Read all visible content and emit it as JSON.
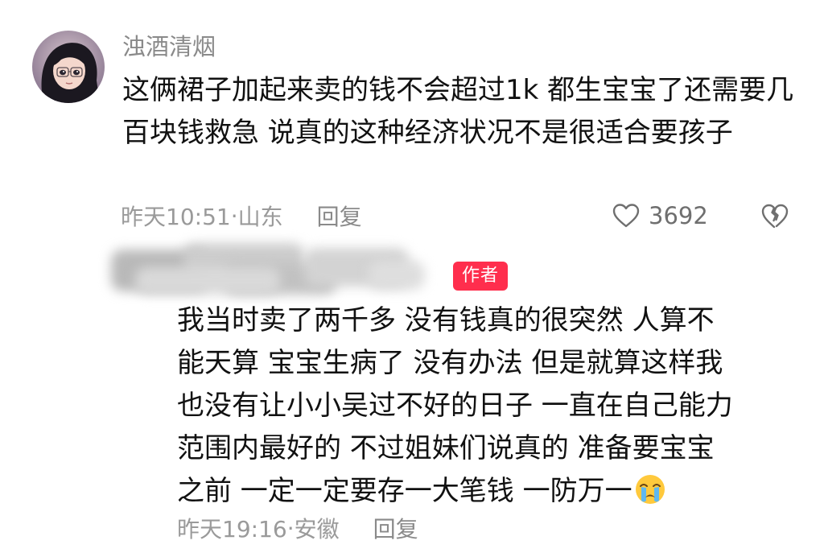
{
  "comment": {
    "username": "浊酒清烟",
    "text": "这俩裙子加起来卖的钱不会超过1k 都生宝宝了还需要几百块钱救急 说真的这种经济状况不是很适合要孩子",
    "time": "昨天10:51",
    "location": "山东",
    "reply_label": "回复",
    "like_count": "3692"
  },
  "reply": {
    "badge": "作者",
    "lines": [
      "我当时卖了两千多 没有钱真的很突然 人算不",
      "能天算 宝宝生病了 没有办法 但是就算这样我",
      "也没有让小小吴过不好的日子 一直在自己能力",
      "范围内最好的 不过姐妹们说真的 准备要宝宝",
      "之前 一定一定要存一大笔钱 一防万一"
    ],
    "emoji": "loudly-crying-face",
    "time": "昨天19:16",
    "location": "安徽",
    "reply_label": "回复"
  },
  "colors": {
    "badge_bg": "#ff2e4d",
    "meta_text": "#9a9a9a",
    "body_text": "#111111"
  }
}
